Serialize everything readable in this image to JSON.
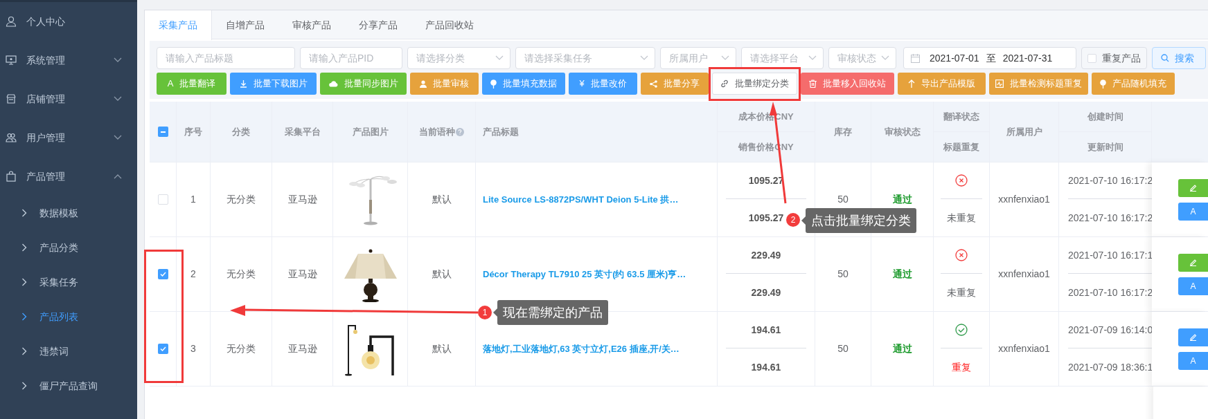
{
  "sidebar": {
    "items": [
      {
        "label": "个人中心",
        "kind": "link"
      },
      {
        "label": "系统管理",
        "kind": "group",
        "expanded": false
      },
      {
        "label": "店铺管理",
        "kind": "group",
        "expanded": false
      },
      {
        "label": "用户管理",
        "kind": "group",
        "expanded": false
      },
      {
        "label": "产品管理",
        "kind": "group",
        "expanded": true,
        "children": [
          {
            "label": "数据模板",
            "selected": false
          },
          {
            "label": "产品分类",
            "selected": false
          },
          {
            "label": "采集任务",
            "selected": false
          },
          {
            "label": "产品列表",
            "selected": true
          },
          {
            "label": "违禁词",
            "selected": false
          },
          {
            "label": "僵尸产品查询",
            "selected": false
          }
        ]
      }
    ]
  },
  "tabs": [
    {
      "label": "采集产品",
      "selected": true
    },
    {
      "label": "自增产品",
      "selected": false
    },
    {
      "label": "审核产品",
      "selected": false
    },
    {
      "label": "分享产品",
      "selected": false
    },
    {
      "label": "产品回收站",
      "selected": false
    }
  ],
  "filters": [
    {
      "placeholder": "请输入产品标题",
      "kind": "input"
    },
    {
      "placeholder": "请输入产品PID",
      "kind": "input"
    },
    {
      "placeholder": "请选择分类",
      "kind": "select"
    },
    {
      "placeholder": "请选择采集任务",
      "kind": "select"
    },
    {
      "placeholder": "所属用户",
      "kind": "select"
    },
    {
      "placeholder": "请选择平台",
      "kind": "select"
    },
    {
      "placeholder": "审核状态",
      "kind": "select"
    }
  ],
  "date_range": {
    "start": "2021-07-01",
    "separator": "至",
    "end": "2021-07-31"
  },
  "duplicate_filter": {
    "label": "重复产品",
    "checked": false
  },
  "search_button": {
    "label": "搜索"
  },
  "actions": [
    {
      "label": "批量翻译",
      "color": "#67c23a",
      "glyph": "A"
    },
    {
      "label": "批量下载图片",
      "color": "#409eff"
    },
    {
      "label": "批量同步图片",
      "color": "#67c23a"
    },
    {
      "label": "批量审核",
      "color": "#e6a23c"
    },
    {
      "label": "批量填充数据",
      "color": "#409eff"
    },
    {
      "label": "批量改价",
      "color": "#409eff",
      "glyph": "¥"
    },
    {
      "label": "批量分享",
      "color": "#e6a23c"
    },
    {
      "label": "批量绑定分类",
      "color": "#ffffff"
    },
    {
      "label": "批量移入回收站",
      "color": "#f56c6c"
    },
    {
      "label": "导出产品模版",
      "color": "#e6a23c"
    },
    {
      "label": "批量检测标题重复",
      "color": "#e6a23c"
    },
    {
      "label": "产品随机填充",
      "color": "#e6a23c"
    }
  ],
  "table": {
    "select_all": {
      "indeterminate": true
    },
    "columns": [
      {
        "label": "序号"
      },
      {
        "label": "分类"
      },
      {
        "label": "采集平台"
      },
      {
        "label": "产品图片"
      },
      {
        "label": "当前语种"
      },
      {
        "label": "产品标题"
      },
      {
        "top": "成本价格CNY",
        "bottom": "销售价格CNY"
      },
      {
        "label": "库存"
      },
      {
        "label": "审核状态"
      },
      {
        "top": "翻译状态",
        "bottom": "标题重复"
      },
      {
        "label": "所属用户"
      },
      {
        "top": "创建时间",
        "bottom": "更新时间"
      }
    ],
    "rows": [
      {
        "selected": false,
        "index": "1",
        "category": "无分类",
        "platform": "亚马逊",
        "language": "默认",
        "title": "Lite Source LS-8872PS/WHT Deion 5-Lite 拱…",
        "cost_price": "1095.27",
        "sale_price": "1095.27",
        "stock": "50",
        "review": "通过",
        "translated": false,
        "duplicate": false,
        "duplicate_label": "未重复",
        "user": "xxnfenxiao1",
        "created": "2021-07-10 16:17:2",
        "updated": "2021-07-10 16:17:2",
        "edit_button": {
          "color": "#67c23a"
        },
        "translate_button": "A"
      },
      {
        "selected": true,
        "index": "2",
        "category": "无分类",
        "platform": "亚马逊",
        "language": "默认",
        "title": "Décor Therapy TL7910 25 英寸(约 63.5 厘米)亨…",
        "cost_price": "229.49",
        "sale_price": "229.49",
        "stock": "50",
        "review": "通过",
        "translated": false,
        "duplicate": false,
        "duplicate_label": "未重复",
        "user": "xxnfenxiao1",
        "created": "2021-07-10 16:17:1",
        "updated": "2021-07-10 16:17:2",
        "edit_button": {
          "color": "#67c23a"
        },
        "translate_button": "A"
      },
      {
        "selected": true,
        "index": "3",
        "category": "无分类",
        "platform": "亚马逊",
        "language": "默认",
        "title": "落地灯,工业落地灯,63 英寸立灯,E26 插座,开/关…",
        "cost_price": "194.61",
        "sale_price": "194.61",
        "stock": "50",
        "review": "通过",
        "translated": true,
        "duplicate": true,
        "duplicate_label": "重复",
        "user": "xxnfenxiao1",
        "created": "2021-07-09 16:14:0",
        "updated": "2021-07-09 18:36:1",
        "edit_button": {
          "color": "#409eff"
        },
        "translate_button": "A"
      }
    ]
  },
  "annotations": [
    {
      "number": "1",
      "text": "现在需绑定的产品"
    },
    {
      "number": "2",
      "text": "点击批量绑定分类"
    }
  ]
}
